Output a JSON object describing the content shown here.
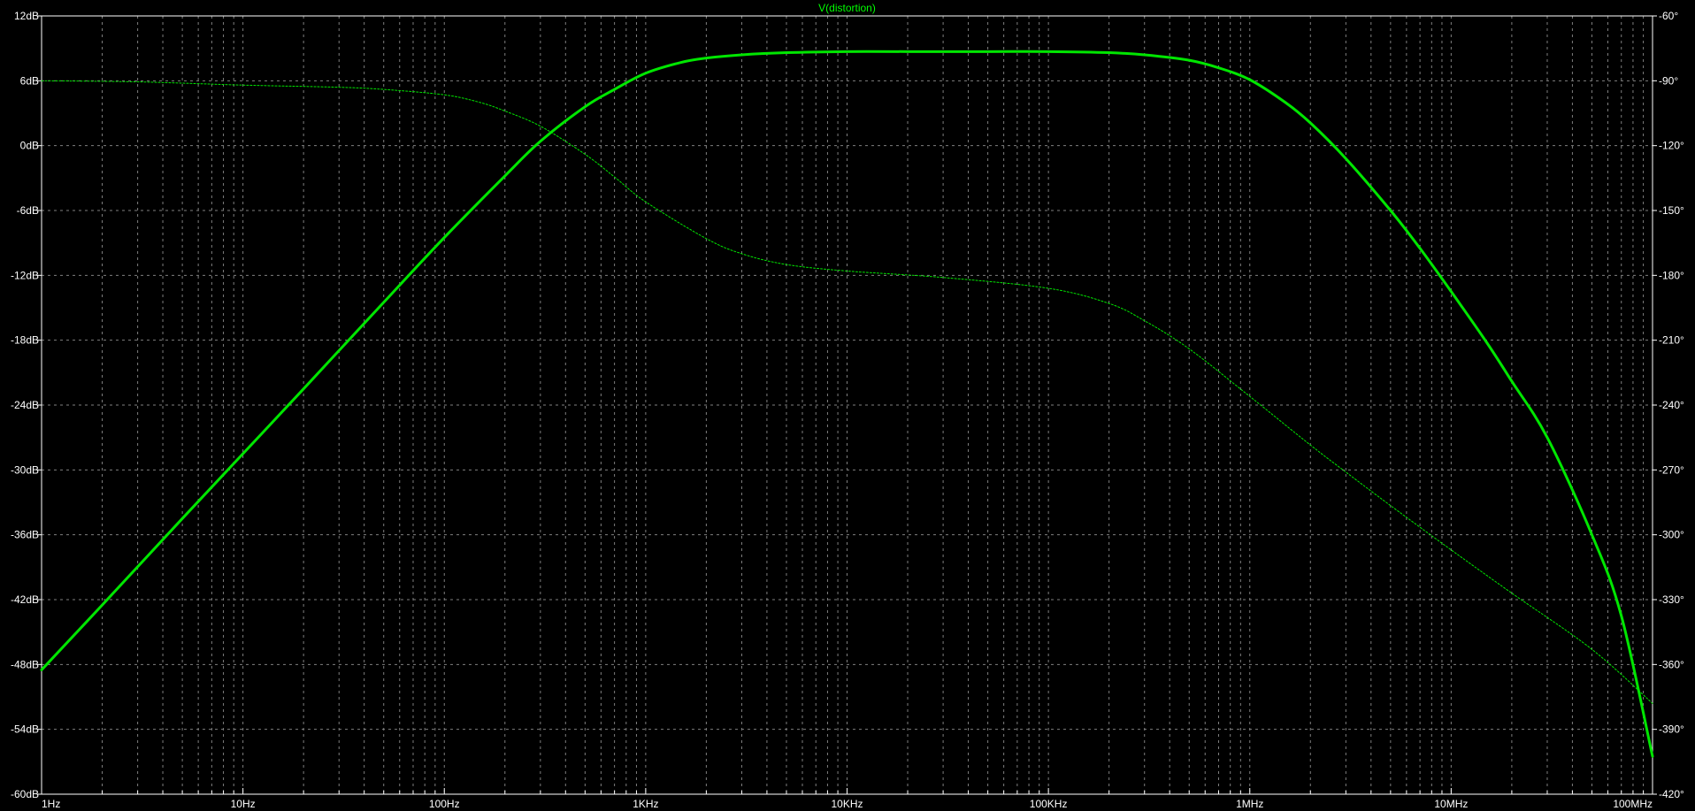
{
  "colors": {
    "background": "#000000",
    "grid": "#7f7f7f",
    "frame": "#ffffff",
    "trace": "#00e600",
    "text": "#ffffff",
    "title": "#00ff00"
  },
  "chart_data": {
    "type": "line",
    "title": "V(distortion)",
    "xscale": "log",
    "xlim": [
      1,
      100000000
    ],
    "ylim_left": [
      -60,
      12
    ],
    "ylim_right": [
      -420,
      -60
    ],
    "grid": true,
    "x_tick_values": [
      1,
      10,
      100,
      1000,
      10000,
      100000,
      1000000,
      10000000,
      100000000
    ],
    "x_tick_labels": [
      "1Hz",
      "10Hz",
      "100Hz",
      "1KHz",
      "10KHz",
      "100KHz",
      "1MHz",
      "10MHz",
      "100MHz"
    ],
    "left_tick_values": [
      12,
      6,
      0,
      -6,
      -12,
      -18,
      -24,
      -30,
      -36,
      -42,
      -48,
      -54,
      -60
    ],
    "left_tick_labels": [
      "12dB",
      "6dB",
      "0dB",
      "-6dB",
      "-12dB",
      "-18dB",
      "-24dB",
      "-30dB",
      "-36dB",
      "-42dB",
      "-48dB",
      "-54dB",
      "-60dB"
    ],
    "right_tick_values": [
      -60,
      -90,
      -120,
      -150,
      -180,
      -210,
      -240,
      -270,
      -300,
      -330,
      -360,
      -390,
      -420
    ],
    "right_tick_labels": [
      "-60°",
      "-90°",
      "-120°",
      "-150°",
      "-180°",
      "-210°",
      "-240°",
      "-270°",
      "-300°",
      "-330°",
      "-360°",
      "-390°",
      "-420°"
    ],
    "series": [
      {
        "axis": "left",
        "style": "solid",
        "x": [
          1,
          2,
          5,
          10,
          20,
          50,
          100,
          200,
          300,
          500,
          700,
          1000,
          1500,
          2000,
          3000,
          5000,
          10000,
          20000,
          50000,
          100000,
          200000,
          300000,
          500000,
          700000,
          1000000,
          1500000,
          2000000,
          3000000,
          5000000,
          7000000,
          10000000,
          15000000,
          20000000,
          30000000,
          50000000,
          70000000,
          100000000
        ],
        "y": [
          -48.5,
          -42.5,
          -34.5,
          -28.5,
          -22.5,
          -14.5,
          -8.5,
          -2.8,
          0.4,
          3.6,
          5.2,
          6.7,
          7.7,
          8.1,
          8.4,
          8.6,
          8.7,
          8.7,
          8.7,
          8.7,
          8.6,
          8.4,
          7.9,
          7.2,
          6.1,
          4.0,
          2.1,
          -1.2,
          -6.0,
          -9.5,
          -13.5,
          -18.2,
          -21.8,
          -27.0,
          -36.0,
          -43.5,
          -56.5
        ]
      },
      {
        "axis": "right",
        "style": "dotted",
        "x": [
          1,
          3,
          10,
          30,
          50,
          100,
          150,
          200,
          300,
          500,
          700,
          1000,
          2000,
          3000,
          5000,
          10000,
          30000,
          100000,
          200000,
          300000,
          500000,
          1000000,
          2000000,
          3000000,
          5000000,
          10000000,
          20000000,
          50000000,
          100000000
        ],
        "y": [
          -90,
          -90.5,
          -92,
          -93,
          -94,
          -96.5,
          -100,
          -104,
          -111,
          -124,
          -134.5,
          -146,
          -163,
          -170,
          -175,
          -178,
          -181,
          -186,
          -193,
          -201,
          -214,
          -236,
          -258.5,
          -271,
          -286.5,
          -307,
          -327,
          -353,
          -378
        ]
      }
    ]
  }
}
